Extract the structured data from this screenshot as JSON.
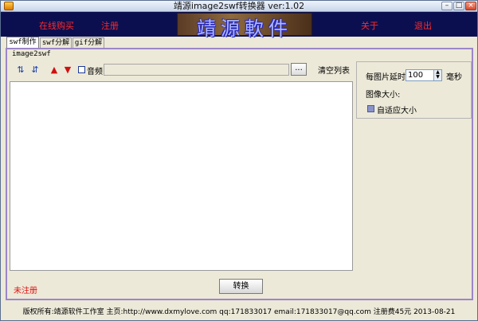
{
  "window": {
    "title": "靖源image2swf转换器 ver:1.02"
  },
  "banner": {
    "left_links": [
      "在线购买",
      "注册"
    ],
    "logo_text": "靖源軟件",
    "right_links": [
      "关于",
      "退出"
    ]
  },
  "tabs": [
    {
      "label": "swf制作",
      "active": true
    },
    {
      "label": "swf分解",
      "active": false
    },
    {
      "label": "gif分解",
      "active": false
    }
  ],
  "panel": {
    "title": "image2swf",
    "audio_label": "音频",
    "browse_label": "...",
    "clear_label": "清空列表",
    "path_value": ""
  },
  "settings": {
    "delay_label": "每图片延时",
    "delay_value": "100",
    "delay_unit": "毫秒",
    "size_label": "图像大小:",
    "autofit_label": "自适应大小",
    "autofit_checked": true
  },
  "status": {
    "unregistered": "未注册",
    "convert_label": "转换"
  },
  "footer": "版权所有:靖源软件工作室 主页:http://www.dxmylove.com qq:171833017 email:171833017@qq.com 注册费45元 2013-08-21",
  "colors": {
    "banner_bg": "#0c0f4f",
    "link_red": "#ff2a2a",
    "panel_border": "#9c86c8"
  }
}
